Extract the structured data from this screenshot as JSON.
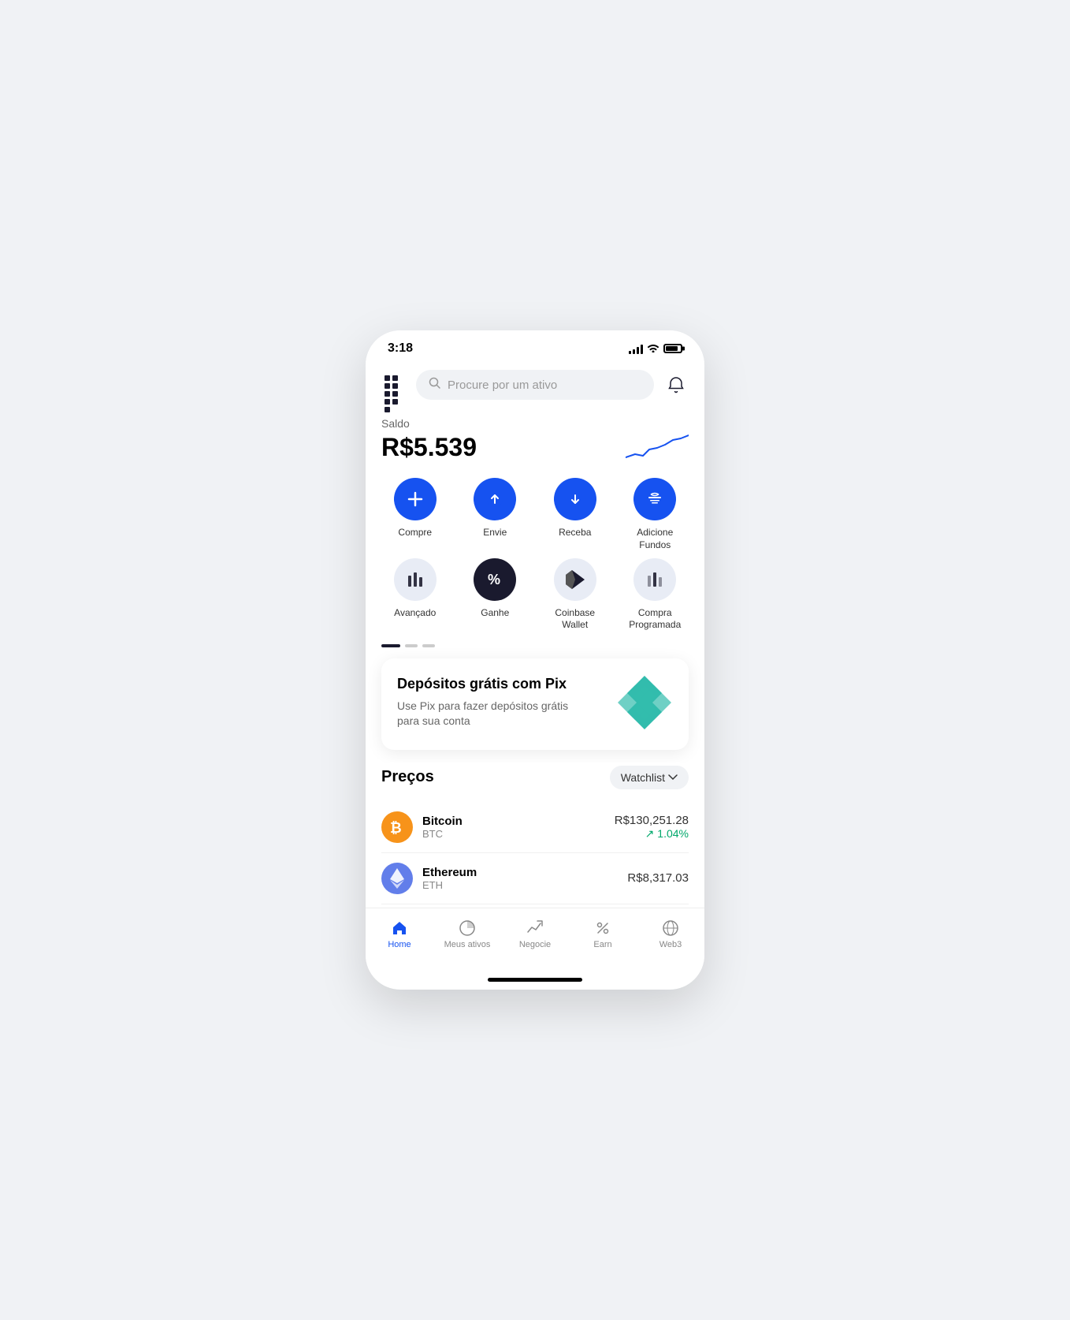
{
  "status": {
    "time": "3:18",
    "signal_bars": [
      4,
      6,
      9,
      12,
      14
    ],
    "battery_level": 85
  },
  "header": {
    "search_placeholder": "Procure por um ativo",
    "grid_icon_label": "apps-icon",
    "bell_icon_label": "bell-icon"
  },
  "balance": {
    "label": "Saldo",
    "amount": "R$5.539"
  },
  "actions": [
    {
      "id": "compre",
      "label": "Compre",
      "type": "primary",
      "icon": "plus"
    },
    {
      "id": "envie",
      "label": "Envie",
      "type": "primary",
      "icon": "send"
    },
    {
      "id": "receba",
      "label": "Receba",
      "type": "primary",
      "icon": "receive"
    },
    {
      "id": "adicione",
      "label": "Adicione\nFundos",
      "type": "primary",
      "icon": "bank"
    },
    {
      "id": "avancado",
      "label": "Avançado",
      "type": "light",
      "icon": "chart"
    },
    {
      "id": "ganhe",
      "label": "Ganhe",
      "type": "light",
      "icon": "percent"
    },
    {
      "id": "coinbase-wallet",
      "label": "Coinbase\nWallet",
      "type": "light",
      "icon": "wallet"
    },
    {
      "id": "compra-programada",
      "label": "Compra\nProgramada",
      "type": "light",
      "icon": "chart2"
    }
  ],
  "carousel": {
    "dots": [
      {
        "active": true
      },
      {
        "active": false
      },
      {
        "active": false
      }
    ],
    "card": {
      "title": "Depósitos grátis com Pix",
      "description": "Use Pix para fazer depósitos grátis para sua conta"
    }
  },
  "prices": {
    "title": "Preços",
    "watchlist_label": "Watchlist",
    "assets": [
      {
        "name": "Bitcoin",
        "symbol": "BTC",
        "price": "R$130,251.28",
        "change": "↗ 1.04%",
        "change_positive": true,
        "logo_type": "btc"
      },
      {
        "name": "Ethereum",
        "symbol": "ETH",
        "price": "R$8,317.03",
        "change": "",
        "change_positive": true,
        "logo_type": "eth"
      }
    ]
  },
  "bottom_nav": [
    {
      "id": "home",
      "label": "Home",
      "active": true,
      "icon": "house"
    },
    {
      "id": "meus-ativos",
      "label": "Meus ativos",
      "active": false,
      "icon": "pie"
    },
    {
      "id": "negocie",
      "label": "Negocie",
      "active": false,
      "icon": "trend"
    },
    {
      "id": "earn",
      "label": "Earn",
      "active": false,
      "icon": "percent"
    },
    {
      "id": "web3",
      "label": "Web3",
      "active": false,
      "icon": "globe"
    }
  ]
}
